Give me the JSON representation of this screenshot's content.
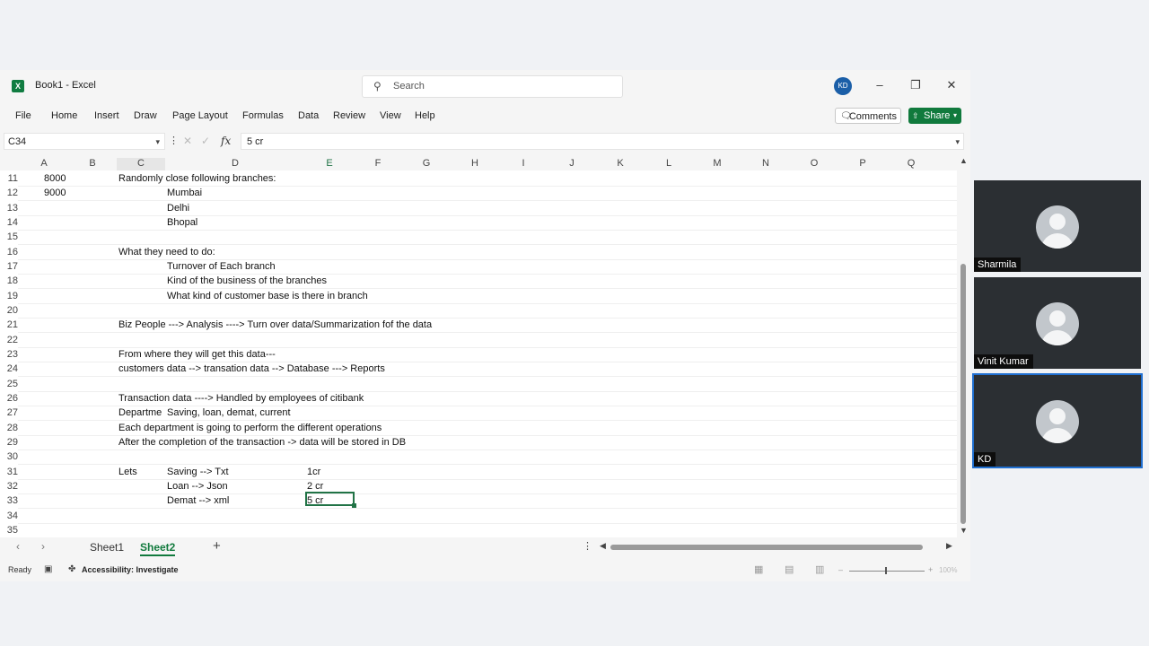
{
  "titlebar": {
    "app_icon": "excel-icon",
    "title": "Book1  -  Excel",
    "search_placeholder": "Search",
    "user_initials": "KD"
  },
  "menu": [
    "File",
    "Home",
    "Insert",
    "Draw",
    "Page Layout",
    "Formulas",
    "Data",
    "Review",
    "View",
    "Help"
  ],
  "comments_label": "Comments",
  "share_label": "Share",
  "formula_bar": {
    "name_box": "C34",
    "fx": "fx",
    "formula": "5 cr"
  },
  "columns": [
    "A",
    "B",
    "C",
    "D",
    "E",
    "F",
    "G",
    "H",
    "I",
    "J",
    "K",
    "L",
    "M",
    "N",
    "O",
    "P",
    "Q"
  ],
  "selected_column": "E",
  "rows": [
    "11",
    "12",
    "13",
    "14",
    "15",
    "16",
    "17",
    "18",
    "19",
    "20",
    "21",
    "22",
    "23",
    "24",
    "25",
    "26",
    "27",
    "28",
    "29",
    "30",
    "31",
    "32",
    "33",
    "34",
    "35"
  ],
  "cells": {
    "a11": "8000",
    "a12": "9000",
    "c11": "Randomly close following branches:",
    "d12": "Mumbai",
    "d13": "Delhi",
    "d14": "Bhopal",
    "c16": "What they need to do:",
    "d17": "Turnover of Each branch",
    "d18": "Kind of the business of the branches",
    "d19": "What kind of customer base is there in branch",
    "c21": "Biz People  --->  Analysis  ----> Turn over data/Summarization fof the data",
    "c23": "From where they will get this data---",
    "c24": "customers data --> transation data --> Database ---> Reports",
    "c26": "Transaction data  ----> Handled by employees of citibank",
    "c27": "Departme",
    "d27": "Saving, loan, demat, current",
    "c28": "Each department is going to perform the different operations",
    "c29": "After the completion of the transaction -> data will be stored in DB",
    "c31": "Lets",
    "d31": "Saving --> Txt",
    "e31": "1cr",
    "d32": "Loan --> Json",
    "e32": "2 cr",
    "d33": "Demat --> xml",
    "e33": "5 cr"
  },
  "sheets": [
    "Sheet1",
    "Sheet2"
  ],
  "active_sheet": "Sheet2",
  "status": {
    "ready": "Ready",
    "accessibility": "Accessibility: Investigate",
    "zoom": "100%"
  },
  "participants": [
    {
      "name": "Sharmila",
      "active": false
    },
    {
      "name": "Vinit Kumar",
      "active": false
    },
    {
      "name": "KD",
      "active": true
    }
  ]
}
